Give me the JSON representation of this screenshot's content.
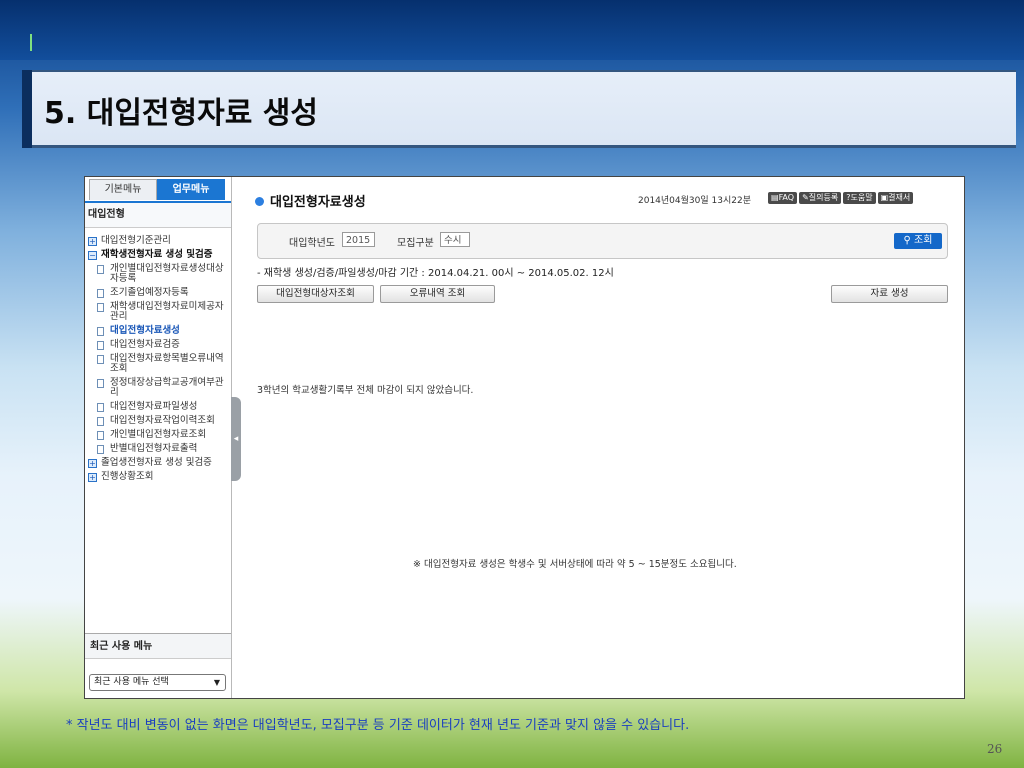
{
  "slide": {
    "title": "5. 대입전형자료 생성",
    "footnote": "* 작년도 대비 변동이 없는 화면은 대입학년도, 모집구분 등 기준 데이터가 현재 년도 기준과 맞지 않을 수 있습니다.",
    "page_number": "26"
  },
  "sidebar": {
    "tabs": [
      "기본메뉴",
      "업무메뉴"
    ],
    "header": "대입전형",
    "items": [
      {
        "label": "대입전형기준관리"
      },
      {
        "label": "재학생전형자료 생성 및검증"
      },
      {
        "label": "개인별대입전형자료생성대상자등록"
      },
      {
        "label": "조기졸업예정자등록"
      },
      {
        "label": "재학생대입전형자료미제공자관리"
      },
      {
        "label": "대입전형자료생성"
      },
      {
        "label": "대입전형자료검증"
      },
      {
        "label": "대입전형자료항목별오류내역조회"
      },
      {
        "label": "정정대장상급학교공개여부관리"
      },
      {
        "label": "대입전형자료파일생성"
      },
      {
        "label": "대입전형자료작업이력조회"
      },
      {
        "label": "개인별대입전형자료조회"
      },
      {
        "label": "반별대입전형자료출력"
      },
      {
        "label": "졸업생전형자료 생성 및검증"
      },
      {
        "label": "진행상황조회"
      }
    ],
    "recent_header": "최근 사용 메뉴",
    "recent_select": "최근 사용 메뉴 선택"
  },
  "main": {
    "page_title": "대입전형자료생성",
    "datetime": "2014년04월30일 13시22분",
    "util_buttons": [
      "FAQ",
      "질의등록",
      "도움말",
      "결재서"
    ],
    "search": {
      "year_label": "대입학년도",
      "year_value": "2015",
      "type_label": "모집구분",
      "type_value": "수시",
      "button": "조회"
    },
    "period_text": "- 재학생 생성/검증/파일생성/마감 기간 : 2014.04.21. 00시 ~ 2014.05.02. 12시",
    "buttons": {
      "target_lookup": "대입전형대상자조회",
      "error_lookup": "오류내역 조회",
      "generate": "자료 생성"
    },
    "message": "3학년의 학교생활기록부 전체 마감이 되지 않았습니다.",
    "note": "※ 대입전형자료 생성은 학생수 및 서버상태에 따라 약 5 ~ 15분정도 소요됩니다."
  },
  "colors": {
    "accent": "#1b76d2",
    "search_button": "#1468c9",
    "footnote_text": "#1a3fbf"
  }
}
